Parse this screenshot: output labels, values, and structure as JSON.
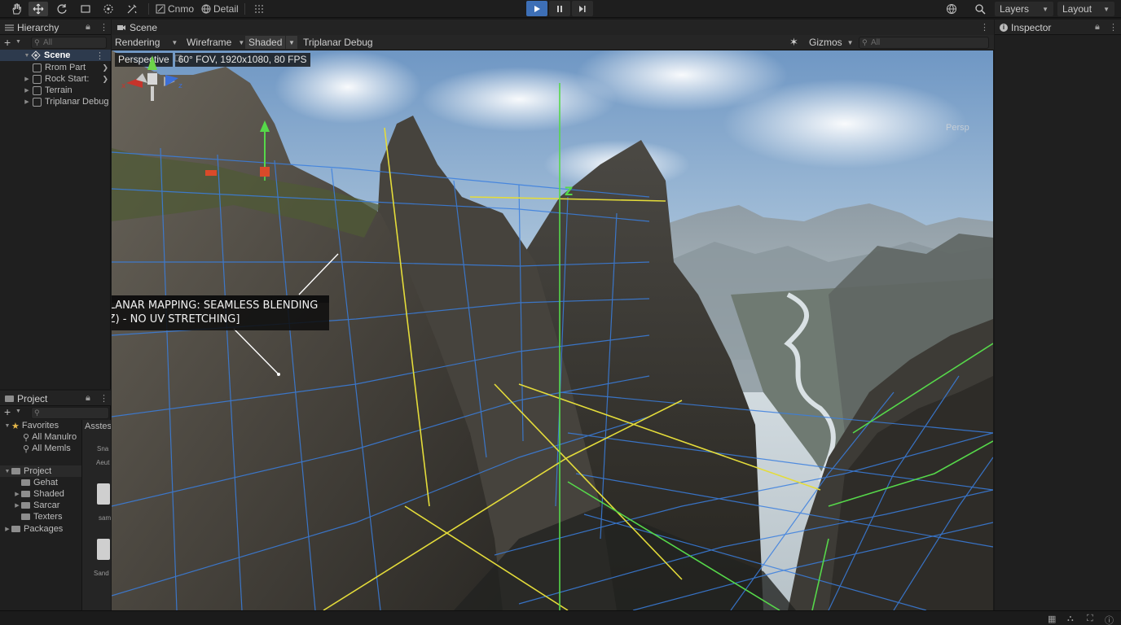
{
  "toolbar": {
    "tools": [
      "hand-tool-icon",
      "move-tool-icon",
      "rotate-tool-icon",
      "rect-tool-icon",
      "transform-tool-icon",
      "custom-tool-icon"
    ],
    "pivot_label": "Cnmo",
    "detail_label": "Detail",
    "layers_label": "Layers",
    "layout_label": "Layout"
  },
  "hierarchy": {
    "title": "Hierarchy",
    "search_placeholder": "All",
    "scene_name": "Scene",
    "items": [
      {
        "label": "Rrom Part"
      },
      {
        "label": "Rock Start:"
      },
      {
        "label": "Terrain"
      },
      {
        "label": "Triplanar Debug"
      }
    ]
  },
  "project": {
    "title": "Project",
    "favorites_label": "Favorites",
    "favorites": [
      "All Manulro",
      "All Memls"
    ],
    "root_label": "Project",
    "folders": [
      "Gehat",
      "Shaded",
      "Sarcar",
      "Texters"
    ],
    "packages_label": "Packages",
    "assets_tab": "Asstes",
    "asset_items": [
      {
        "label": "Sna",
        "sub": "Aeut"
      },
      {
        "label": "sam"
      },
      {
        "label": "Sand"
      }
    ]
  },
  "scene": {
    "tab_label": "Scene",
    "rendering_label": "Rendering",
    "wireframe_label": "Wireframe",
    "shaded_label": "Shaded",
    "debug_label": "Triplanar Debug",
    "gizmos_label": "Gizmos",
    "search_placeholder": "All",
    "camera_mode": "Perspective",
    "camera_stats": "60° FOV, 1920x1080, 80 FPS",
    "callout_line1": "[TRIPLANAR MAPPING: SEAMLESS BLENDING",
    "callout_line2": "(X/Y/Z) - NO UV STRETCHING]",
    "axis_z_label": "Z",
    "persp_label": "Persp",
    "gizmo_x": "x",
    "gizmo_z": "z"
  },
  "inspector": {
    "title": "Inspector"
  },
  "colors": {
    "accent_play": "#3d6fb6",
    "grid_blue": "#3a7fe0",
    "grid_yellow": "#e4dc3a",
    "grid_green": "#56d84a"
  }
}
